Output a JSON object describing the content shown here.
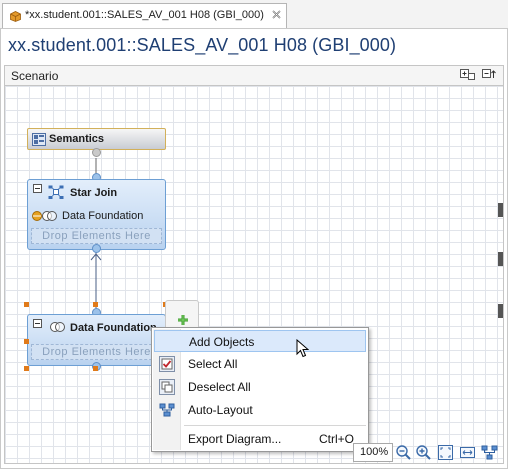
{
  "tab": {
    "title": "*xx.student.001::SALES_AV_001 H08 (GBI_000)"
  },
  "editor": {
    "title": "xx.student.001::SALES_AV_001 H08 (GBI_000)"
  },
  "scenario": {
    "label": "Scenario"
  },
  "nodes": {
    "semantics": {
      "title": "Semantics"
    },
    "star_join": {
      "title": "Star Join",
      "child": "Data Foundation",
      "drop": "Drop Elements Here"
    },
    "data_foundation": {
      "title": "Data Foundation",
      "drop": "Drop Elements Here"
    }
  },
  "context_menu": {
    "items": [
      {
        "label": "Add Objects",
        "shortcut": ""
      },
      {
        "label": "Select All",
        "shortcut": ""
      },
      {
        "label": "Deselect All",
        "shortcut": ""
      },
      {
        "label": "Auto-Layout",
        "shortcut": ""
      },
      {
        "label": "Export Diagram...",
        "shortcut": "Ctrl+O"
      }
    ]
  },
  "zoom": {
    "value": "100%"
  },
  "colors": {
    "title": "#1f3f73",
    "node_border": "#6d9fd4",
    "node_fill": "#b9d2ef",
    "handle": "#e07a1a",
    "menu_hover": "#dbe9fb"
  }
}
